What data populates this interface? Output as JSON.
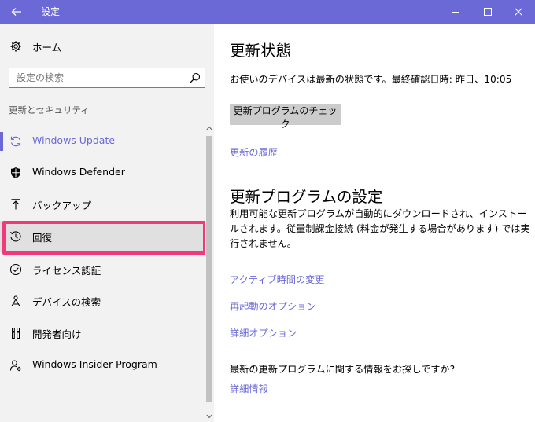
{
  "window": {
    "title": "設定"
  },
  "sidebar": {
    "home_label": "ホーム",
    "search_placeholder": "設定の検索",
    "section_label": "更新とセキュリティ",
    "items": [
      {
        "label": "Windows Update",
        "icon": "sync-icon",
        "active": true
      },
      {
        "label": "Windows Defender",
        "icon": "shield-icon"
      },
      {
        "label": "バックアップ",
        "icon": "backup-arrow-icon"
      },
      {
        "label": "回復",
        "icon": "history-icon",
        "highlighted": true
      },
      {
        "label": "ライセンス認証",
        "icon": "check-circle-icon"
      },
      {
        "label": "デバイスの検索",
        "icon": "find-device-icon"
      },
      {
        "label": "開発者向け",
        "icon": "developer-icon"
      },
      {
        "label": "Windows Insider Program",
        "icon": "insider-icon"
      }
    ]
  },
  "main": {
    "status_heading": "更新状態",
    "status_text": "お使いのデバイスは最新の状態です。最終確認日時: 昨日、10:05",
    "check_button": "更新プログラムのチェック",
    "history_link": "更新の履歴",
    "settings_heading": "更新プログラムの設定",
    "settings_paragraph": "利用可能な更新プログラムが自動的にダウンロードされ、インストールされます。従量制課金接続 (料金が発生する場合があります) では実行されません。",
    "active_hours_link": "アクティブ時間の変更",
    "restart_options_link": "再起動のオプション",
    "advanced_options_link": "詳細オプション",
    "question_text": "最新の更新プログラムに関する情報をお探しですか?",
    "more_info_link": "詳細情報"
  },
  "colors": {
    "accent": "#6b69d6",
    "highlight": "#f0387a",
    "sidebar_bg": "#f2f2f2"
  }
}
